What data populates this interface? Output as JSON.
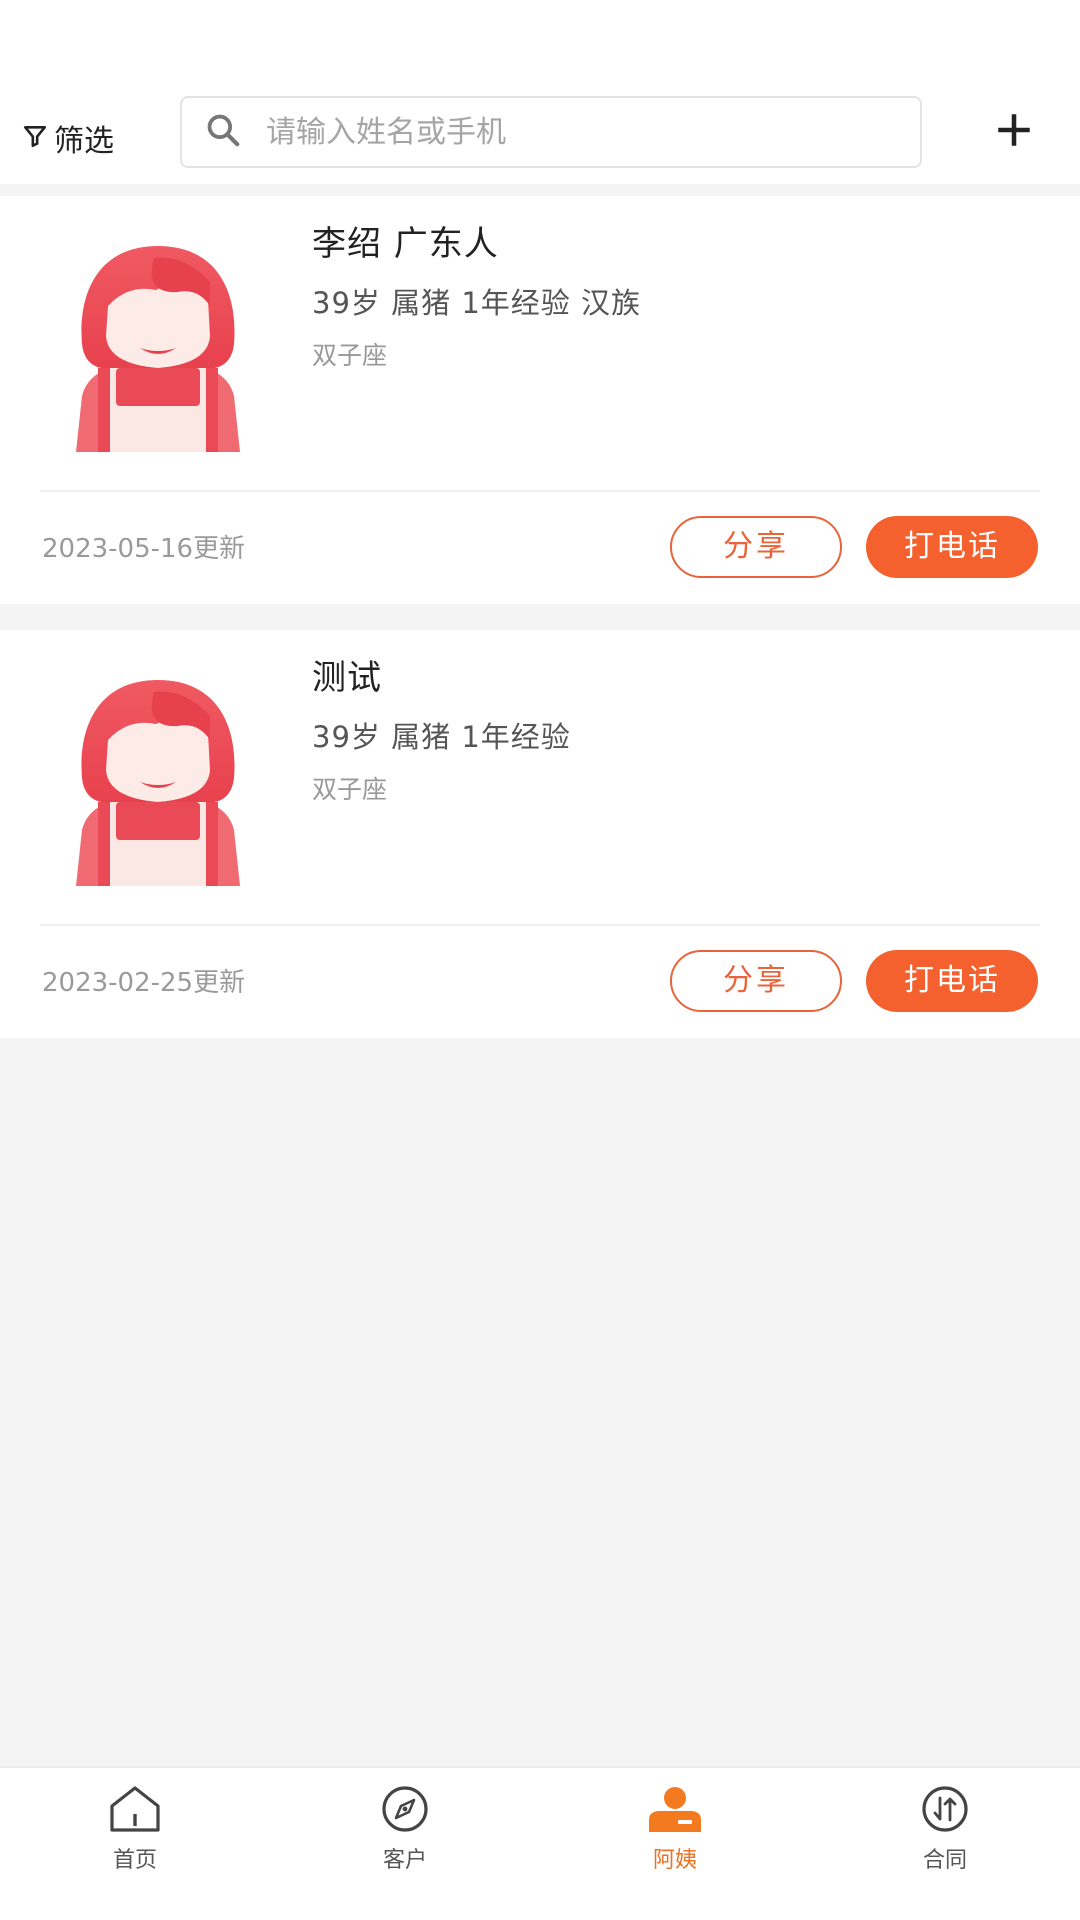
{
  "header": {
    "filter_label": "筛选",
    "search_placeholder": "请输入姓名或手机"
  },
  "cards": [
    {
      "name": "李绍  广东人",
      "meta": "39岁 属猪 1年经验 汉族",
      "sign": "双子座",
      "updated": "2023-05-16更新",
      "share_label": "分享",
      "call_label": "打电话"
    },
    {
      "name": "测试",
      "meta": "39岁 属猪 1年经验",
      "sign": "双子座",
      "updated": "2023-02-25更新",
      "share_label": "分享",
      "call_label": "打电话"
    }
  ],
  "tabbar": {
    "tabs": [
      {
        "label": "首页",
        "icon": "home-icon"
      },
      {
        "label": "客户",
        "icon": "compass-icon"
      },
      {
        "label": "阿姨",
        "icon": "person-icon",
        "active": true
      },
      {
        "label": "合同",
        "icon": "swap-icon"
      }
    ]
  },
  "colors": {
    "accent": "#f4612f",
    "active_tab": "#f07022",
    "avatar": "#ee4f59"
  }
}
